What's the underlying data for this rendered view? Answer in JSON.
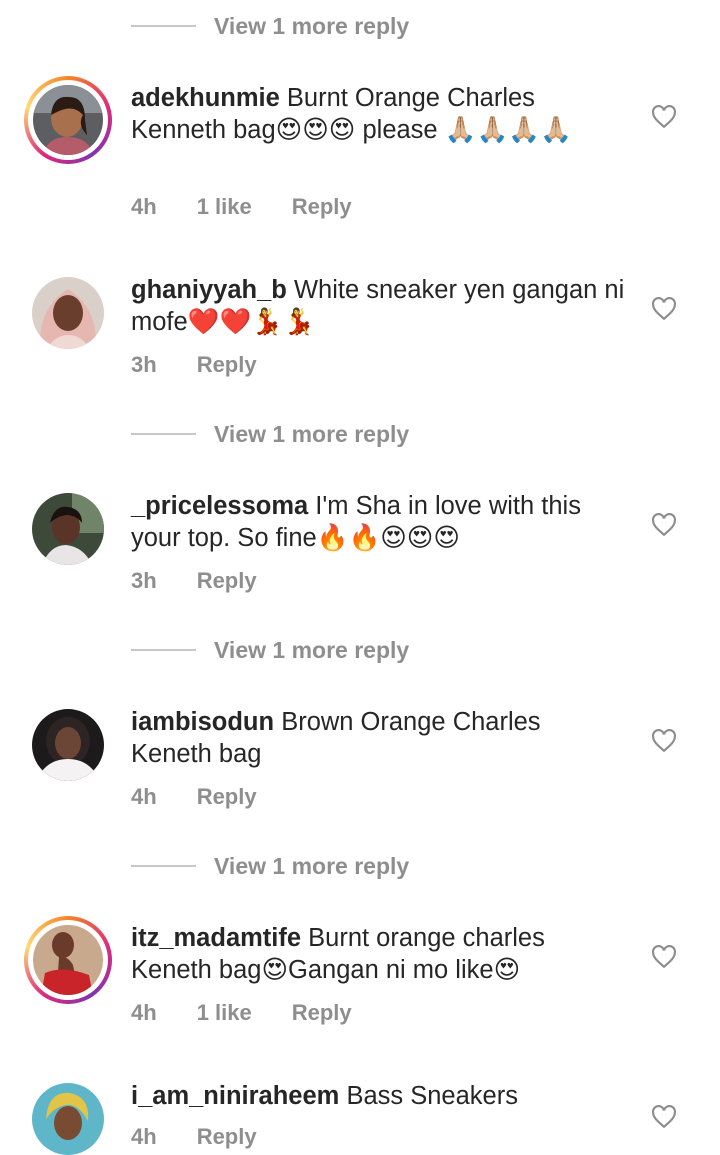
{
  "view_more_label": "View 1 more reply",
  "comments": [
    {
      "username": "adekhunmie",
      "text": "Burnt Orange Charles Kenneth bag😍😍😍 please 🙏🏼🙏🏼🙏🏼🙏🏼",
      "time": "4h",
      "likes": "1 like",
      "reply_label": "Reply"
    },
    {
      "username": "ghaniyyah_b",
      "text": "White sneaker yen gangan ni mofe❤️❤️💃💃",
      "time": "3h",
      "reply_label": "Reply"
    },
    {
      "username": "_pricelessoma",
      "text": "I'm Sha in love with this your top. So fine🔥🔥😍😍😍",
      "time": "3h",
      "reply_label": "Reply"
    },
    {
      "username": "iambisodun",
      "text": "Brown  Orange Charles Keneth bag",
      "time": "4h",
      "reply_label": "Reply"
    },
    {
      "username": "itz_madamtife",
      "text": "Burnt orange charles Keneth bag😍Gangan ni mo like😍",
      "time": "4h",
      "likes": "1 like",
      "reply_label": "Reply"
    },
    {
      "username": "i_am_niniraheem",
      "text": "Bass Sneakers",
      "time": "4h",
      "reply_label": "Reply"
    }
  ]
}
